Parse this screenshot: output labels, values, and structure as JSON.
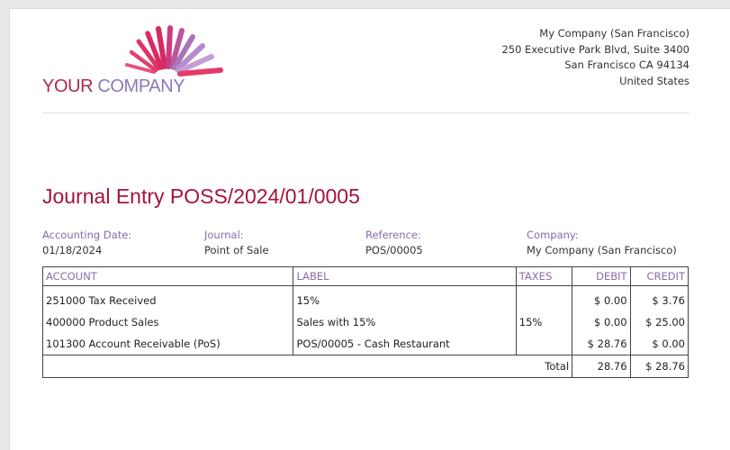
{
  "company_logo": {
    "word1": "YOUR",
    "word2": "COMPANY",
    "brand_primary": "#b0264f",
    "brand_secondary": "#9077b8"
  },
  "address": {
    "line1": "My Company (San Francisco)",
    "line2": "250 Executive Park Blvd, Suite 3400",
    "line3": "San Francisco CA 94134",
    "line4": "United States"
  },
  "title": "Journal Entry POSS/2024/01/0005",
  "info": {
    "accounting_date_label": "Accounting Date:",
    "accounting_date": "01/18/2024",
    "journal_label": "Journal:",
    "journal": "Point of Sale",
    "reference_label": "Reference:",
    "reference": "POS/00005",
    "company_label": "Company:",
    "company": "My Company (San Francisco)"
  },
  "table": {
    "headers": {
      "account": "ACCOUNT",
      "label": "LABEL",
      "taxes": "TAXES",
      "debit": "DEBIT",
      "credit": "CREDIT"
    },
    "rows": [
      {
        "account": "251000 Tax Received",
        "label": "15%",
        "taxes": "",
        "debit": "$ 0.00",
        "credit": "$ 3.76"
      },
      {
        "account": "400000 Product Sales",
        "label": "Sales with 15%",
        "taxes": "15%",
        "debit": "$ 0.00",
        "credit": "$ 25.00"
      },
      {
        "account": "101300 Account Receivable (PoS)",
        "label": "POS/00005 - Cash Restaurant",
        "taxes": "",
        "debit": "$ 28.76",
        "credit": "$ 0.00"
      }
    ],
    "total": {
      "label": "Total",
      "debit": "28.76",
      "credit": "$ 28.76"
    }
  }
}
